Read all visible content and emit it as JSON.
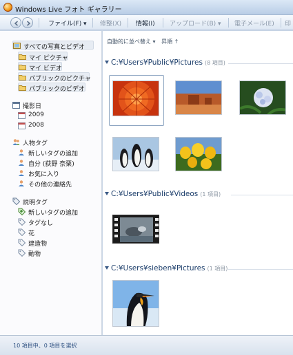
{
  "window": {
    "title": "Windows Live フォト ギャラリー"
  },
  "toolbar": {
    "items": [
      {
        "label": "ファイル(F) ▾",
        "enabled": true
      },
      {
        "label": "修整(X)",
        "enabled": false
      },
      {
        "label": "情報(I)",
        "enabled": true
      },
      {
        "label": "アップロード(B) ▾",
        "enabled": false
      },
      {
        "label": "電子メール(E)",
        "enabled": false
      },
      {
        "label": "印",
        "enabled": false
      }
    ]
  },
  "sidebar": {
    "library": {
      "all": "すべての写真とビデオ",
      "items": [
        "マイ ピクチャ",
        "マイ ビデオ",
        "パブリックのピクチャ",
        "パブリックのビデオ"
      ]
    },
    "date": {
      "header": "撮影日",
      "items": [
        "2009",
        "2008"
      ]
    },
    "people": {
      "header": "人物タグ",
      "items": [
        "新しいタグの追加",
        "自分 (荻野 奈栗)",
        "お気に入り",
        "その他の連絡先"
      ]
    },
    "tags": {
      "header": "説明タグ",
      "items": [
        "新しいタグの追加",
        "タグなし",
        "花",
        "建造物",
        "動物"
      ]
    }
  },
  "main": {
    "sort": {
      "arrange": "自動的に並べ替え ▾",
      "order": "昇順 ↑"
    },
    "sections": [
      {
        "path": "C:¥Users¥Public¥Pictures",
        "count": "(8 項目)"
      },
      {
        "path": "C:¥Users¥Public¥Videos",
        "count": "(1 項目)"
      },
      {
        "path": "C:¥Users¥sieben¥Pictures",
        "count": "(1 項目)"
      }
    ]
  },
  "status": {
    "text": "10 項目中、0 項目を選択"
  },
  "colors": {
    "sidebar_selected": "#e7ecf3",
    "section_title": "#1b3d6a",
    "status_text": "#2c4f80"
  }
}
